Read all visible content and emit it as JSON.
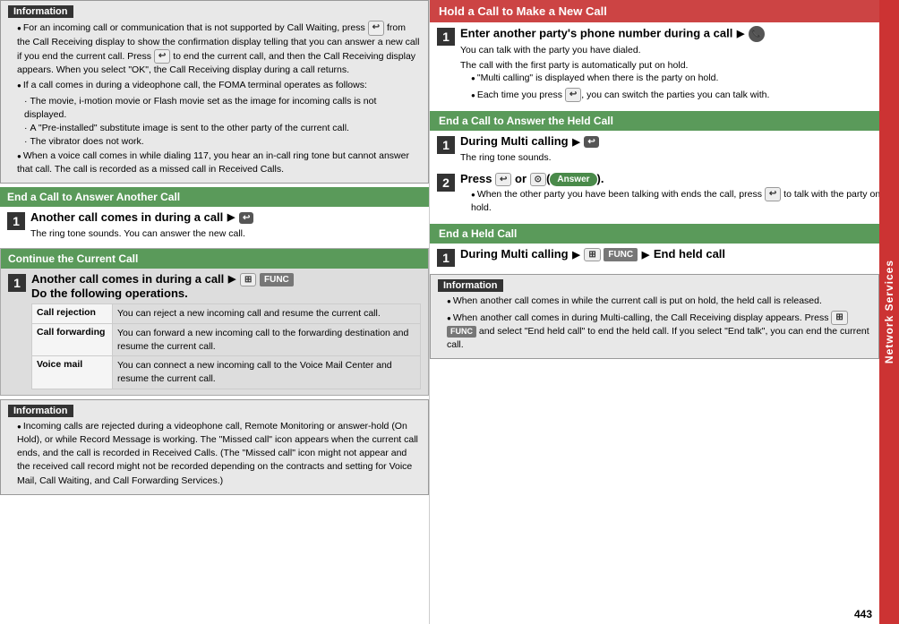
{
  "left": {
    "info_section": {
      "title": "Information",
      "items": [
        "For an incoming call or communication that is not supported by Call Waiting, press from the Call Receiving display to show the confirmation display telling that you can answer a new call if you end the current call. Press to end the current call, and then the Call Receiving display appears. When you select \"OK\", the Call Receiving display during a call returns.",
        "If a call comes in during a videophone call, the FOMA terminal operates as follows:",
        "· The movie, i-motion movie or Flash movie set as the image for incoming calls is not displayed.",
        "· A \"Pre-installed\" substitute image is sent to the other party of the current call.",
        "· The vibrator does not work.",
        "When a voice call comes in while dialing 117, you hear an in-call ring tone but cannot answer that call. The call is recorded as a missed call in Received Calls."
      ]
    },
    "end_answer_section": {
      "header": "End a Call to Answer Another Call",
      "step1_title": "Another call comes in during a call",
      "step1_desc": "The ring tone sounds. You can answer the new call."
    },
    "continue_section": {
      "header": "Continue the Current Call",
      "step1_title": "Another call comes in during a call",
      "step1_title2": "Do the following operations.",
      "table": [
        {
          "key": "Call rejection",
          "value": "You can reject a new incoming call and resume the current call."
        },
        {
          "key": "Call forwarding",
          "value": "You can forward a new incoming call to the forwarding destination and resume the current call."
        },
        {
          "key": "Voice mail",
          "value": "You can connect a new incoming call to the Voice Mail Center and resume the current call."
        }
      ]
    },
    "info2_section": {
      "title": "Information",
      "items": [
        "Incoming calls are rejected during a videophone call, Remote Monitoring or answer-hold (On Hold), or while Record Message is working. The \"Missed call\" icon appears when the current call ends, and the call is recorded in Received Calls. (The \"Missed call\" icon might not appear and the received call record might not be recorded depending on the contracts and setting for Voice Mail, Call Waiting, and Call Forwarding Services.)"
      ]
    }
  },
  "right": {
    "hold_section": {
      "header": "Hold a Call to Make a New Call",
      "step1_title": "Enter another party's phone number during a call",
      "step1_desc1": "You can talk with the party you have dialed.",
      "step1_desc2": "The call with the first party is automatically put on hold.",
      "step1_bullet1": "\"Multi calling\" is displayed when there is the party on hold.",
      "step1_bullet2": "Each time you press , you can switch the parties you can talk with."
    },
    "end_held_answer": {
      "header": "End a Call to Answer the Held Call",
      "step1_title": "During Multi calling",
      "step1_desc": "The ring tone sounds.",
      "step2_title": "Press  or  ( Answer ).",
      "step2_bullet": "When the other party you have been talking with ends the call, press to talk with the party on hold."
    },
    "end_held_call": {
      "header": "End a Held Call",
      "step1_title": "During Multi calling",
      "step1_title2": "End held call"
    },
    "info_section": {
      "title": "Information",
      "items": [
        "When another call comes in while the current call is put on hold, the held call is released.",
        "When another call comes in during Multi-calling, the Call Receiving display appears. Press and select \"End held call\" to end the held call. If you select \"End talk\", you can end the current call."
      ]
    },
    "network_services": "Network Services",
    "page_number": "443"
  }
}
